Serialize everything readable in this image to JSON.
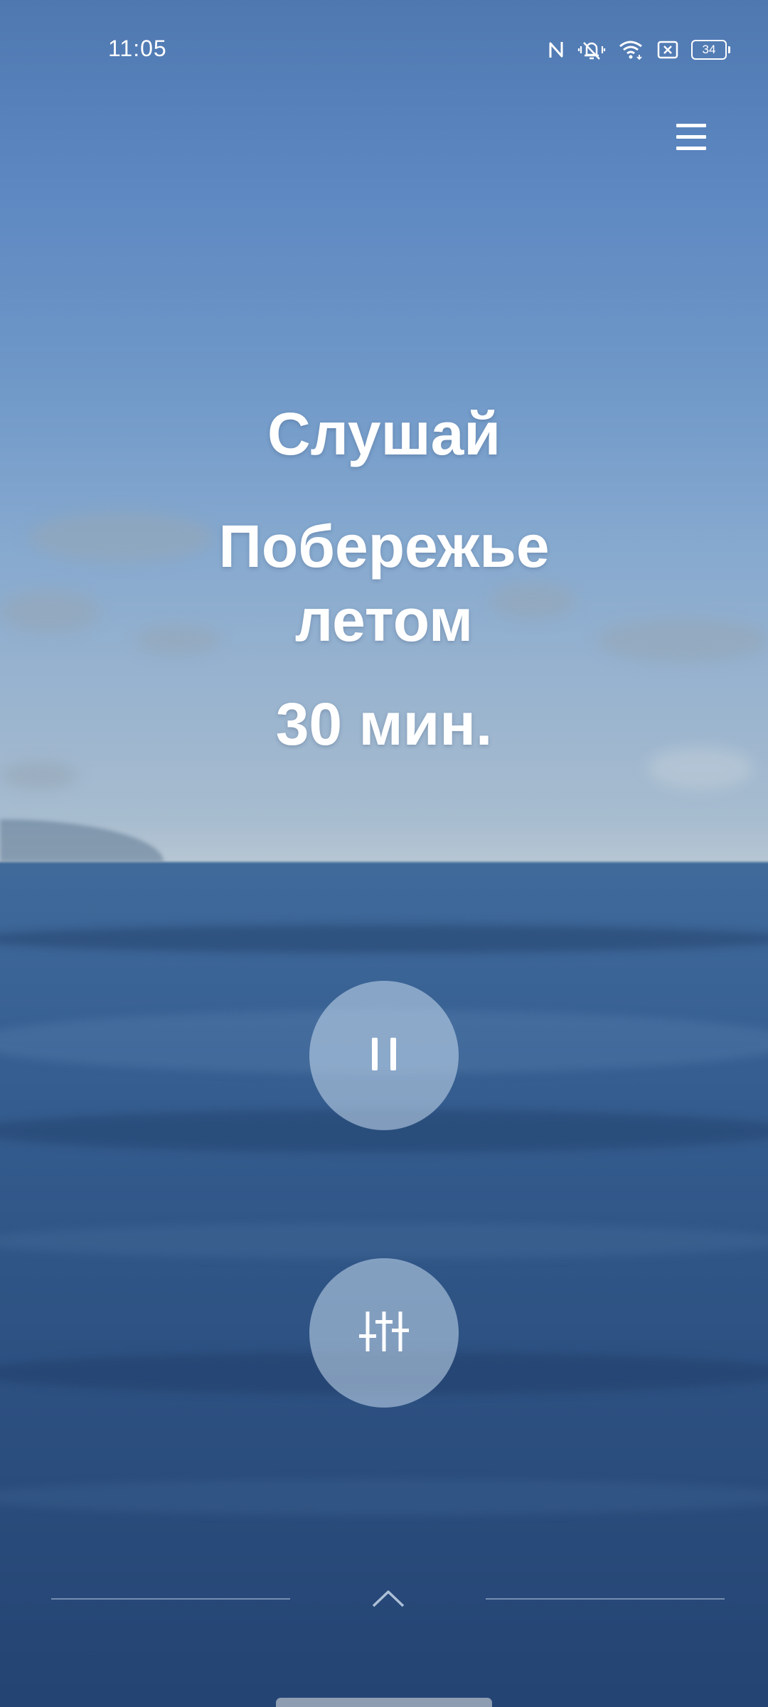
{
  "status_bar": {
    "time": "11:05",
    "battery": "34",
    "icons": [
      "nfc-icon",
      "vibrate-icon",
      "wifi-icon",
      "sim-off-icon",
      "battery-icon"
    ]
  },
  "header": {
    "menu_icon": "hamburger-menu-icon"
  },
  "main": {
    "mode_label": "Слушай",
    "sound_title": "Побережье летом",
    "duration": "30 мин."
  },
  "controls": {
    "pause_icon": "pause-icon",
    "mixer_icon": "sliders-icon"
  },
  "bottom": {
    "expand_icon": "chevron-up-icon"
  },
  "colors": {
    "sky": "#5b86c0",
    "sea": "#2f5586",
    "button_fill": "#c8dcf0"
  }
}
